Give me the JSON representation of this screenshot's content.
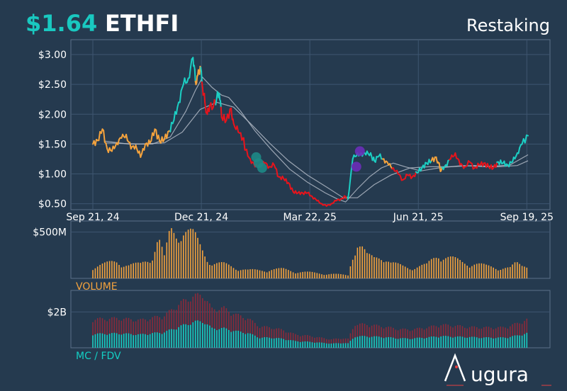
{
  "header": {
    "price": "$1.64",
    "ticker": "ETHFI",
    "category": "Restaking"
  },
  "colors": {
    "background": "#253a4f",
    "grid": "#3e5670",
    "frame": "#5a7088",
    "price_up": "#1ccfc4",
    "price_down": "#e8141c",
    "price_neutral": "#f5a33d",
    "ma": "#b0b8c4",
    "volume": "#f5a33d",
    "mcap": "#13cfc4",
    "fdv": "#8a2a3a",
    "marker_teal": "#1e8a86",
    "marker_purple": "#6c2fb8",
    "label": "#ffffff",
    "logo_accent": "#e84040"
  },
  "logo": {
    "text": "ugura"
  },
  "chart_data": [
    {
      "type": "line",
      "panel": "price",
      "x_ticks": [
        "Sep 21, 24",
        "Dec 21, 24",
        "Mar 22, 25",
        "Jun 21, 25",
        "Sep 19, 25"
      ],
      "y_ticks": [
        "$0.50",
        "$1.00",
        "$1.50",
        "$2.00",
        "$2.50",
        "$3.00"
      ],
      "ylim": [
        0.4,
        3.25
      ],
      "x_day_range": [
        0,
        365
      ],
      "grid": true,
      "series": [
        {
          "role": "price",
          "points": [
            [
              0,
              1.5
            ],
            [
              4,
              1.56
            ],
            [
              8,
              1.75
            ],
            [
              12,
              1.42
            ],
            [
              16,
              1.38
            ],
            [
              20,
              1.52
            ],
            [
              24,
              1.6
            ],
            [
              28,
              1.66
            ],
            [
              32,
              1.42
            ],
            [
              36,
              1.48
            ],
            [
              40,
              1.28
            ],
            [
              44,
              1.5
            ],
            [
              48,
              1.52
            ],
            [
              52,
              1.75
            ],
            [
              56,
              1.55
            ],
            [
              60,
              1.58
            ],
            [
              64,
              1.72
            ],
            [
              68,
              1.9
            ],
            [
              72,
              2.2
            ],
            [
              76,
              2.5
            ],
            [
              80,
              2.6
            ],
            [
              84,
              2.95
            ],
            [
              86,
              2.55
            ],
            [
              88,
              2.65
            ],
            [
              90,
              2.8
            ],
            [
              92,
              2.45
            ],
            [
              94,
              2.2
            ],
            [
              96,
              2.0
            ],
            [
              98,
              2.15
            ],
            [
              100,
              2.08
            ],
            [
              104,
              2.28
            ],
            [
              106,
              2.35
            ],
            [
              108,
              1.95
            ],
            [
              112,
              1.9
            ],
            [
              116,
              2.1
            ],
            [
              118,
              1.85
            ],
            [
              122,
              1.7
            ],
            [
              126,
              1.6
            ],
            [
              128,
              1.4
            ],
            [
              132,
              1.25
            ],
            [
              136,
              1.12
            ],
            [
              140,
              1.15
            ],
            [
              144,
              1.18
            ],
            [
              148,
              1.12
            ],
            [
              152,
              1.15
            ],
            [
              156,
              0.95
            ],
            [
              160,
              0.92
            ],
            [
              164,
              0.85
            ],
            [
              168,
              0.7
            ],
            [
              172,
              0.68
            ],
            [
              176,
              0.68
            ],
            [
              180,
              0.68
            ],
            [
              184,
              0.62
            ],
            [
              188,
              0.55
            ],
            [
              192,
              0.5
            ],
            [
              196,
              0.46
            ],
            [
              200,
              0.5
            ],
            [
              204,
              0.55
            ],
            [
              208,
              0.58
            ],
            [
              212,
              0.62
            ],
            [
              214,
              0.58
            ],
            [
              218,
              1.25
            ],
            [
              222,
              1.35
            ],
            [
              226,
              1.3
            ],
            [
              230,
              1.38
            ],
            [
              234,
              1.28
            ],
            [
              236,
              1.22
            ],
            [
              240,
              1.3
            ],
            [
              244,
              1.25
            ],
            [
              248,
              1.15
            ],
            [
              252,
              1.1
            ],
            [
              256,
              1.0
            ],
            [
              260,
              0.9
            ],
            [
              264,
              0.98
            ],
            [
              268,
              0.95
            ],
            [
              272,
              1.02
            ],
            [
              276,
              1.1
            ],
            [
              280,
              1.18
            ],
            [
              284,
              1.22
            ],
            [
              288,
              1.28
            ],
            [
              290,
              1.18
            ],
            [
              292,
              1.05
            ],
            [
              296,
              1.15
            ],
            [
              300,
              1.25
            ],
            [
              304,
              1.35
            ],
            [
              308,
              1.15
            ],
            [
              312,
              1.12
            ],
            [
              316,
              1.2
            ],
            [
              320,
              1.1
            ],
            [
              324,
              1.15
            ],
            [
              328,
              1.18
            ],
            [
              332,
              1.12
            ],
            [
              336,
              1.1
            ],
            [
              340,
              1.2
            ],
            [
              344,
              1.18
            ],
            [
              348,
              1.15
            ],
            [
              352,
              1.2
            ],
            [
              356,
              1.35
            ],
            [
              360,
              1.5
            ],
            [
              365,
              1.64
            ]
          ]
        },
        {
          "role": "moving-average-1",
          "points": [
            [
              10,
              1.55
            ],
            [
              30,
              1.5
            ],
            [
              50,
              1.5
            ],
            [
              65,
              1.62
            ],
            [
              78,
              2.05
            ],
            [
              86,
              2.4
            ],
            [
              92,
              2.62
            ],
            [
              100,
              2.45
            ],
            [
              108,
              2.32
            ],
            [
              114,
              2.28
            ],
            [
              124,
              2.05
            ],
            [
              136,
              1.72
            ],
            [
              150,
              1.4
            ],
            [
              165,
              1.08
            ],
            [
              180,
              0.86
            ],
            [
              195,
              0.68
            ],
            [
              205,
              0.58
            ],
            [
              212,
              0.53
            ],
            [
              222,
              0.75
            ],
            [
              232,
              0.95
            ],
            [
              242,
              1.1
            ],
            [
              252,
              1.18
            ],
            [
              262,
              1.12
            ],
            [
              275,
              1.05
            ],
            [
              290,
              1.1
            ],
            [
              310,
              1.14
            ],
            [
              330,
              1.12
            ],
            [
              350,
              1.15
            ],
            [
              365,
              1.32
            ]
          ]
        },
        {
          "role": "moving-average-2",
          "points": [
            [
              10,
              1.52
            ],
            [
              40,
              1.5
            ],
            [
              60,
              1.52
            ],
            [
              75,
              1.7
            ],
            [
              90,
              2.08
            ],
            [
              104,
              2.2
            ],
            [
              118,
              2.12
            ],
            [
              132,
              1.85
            ],
            [
              148,
              1.52
            ],
            [
              164,
              1.22
            ],
            [
              180,
              0.98
            ],
            [
              196,
              0.78
            ],
            [
              210,
              0.6
            ],
            [
              222,
              0.6
            ],
            [
              236,
              0.82
            ],
            [
              250,
              0.98
            ],
            [
              266,
              1.1
            ],
            [
              282,
              1.12
            ],
            [
              300,
              1.12
            ],
            [
              320,
              1.14
            ],
            [
              340,
              1.12
            ],
            [
              356,
              1.14
            ],
            [
              365,
              1.22
            ]
          ]
        }
      ],
      "markers": [
        {
          "x": 137,
          "y": 1.28,
          "color": "teal"
        },
        {
          "x": 139,
          "y": 1.18,
          "color": "teal"
        },
        {
          "x": 142,
          "y": 1.1,
          "color": "teal"
        },
        {
          "x": 221,
          "y": 1.12,
          "color": "purple"
        },
        {
          "x": 224,
          "y": 1.38,
          "color": "purple"
        }
      ]
    },
    {
      "type": "bar",
      "panel": "volume",
      "label": "VOLUME",
      "y_ticks": [
        "$500M"
      ],
      "ylim": [
        0,
        620
      ],
      "keypoints": [
        [
          0,
          120
        ],
        [
          10,
          140
        ],
        [
          20,
          170
        ],
        [
          30,
          130
        ],
        [
          40,
          140
        ],
        [
          50,
          230
        ],
        [
          55,
          400
        ],
        [
          60,
          200
        ],
        [
          65,
          480
        ],
        [
          70,
          460
        ],
        [
          75,
          500
        ],
        [
          80,
          460
        ],
        [
          85,
          420
        ],
        [
          90,
          320
        ],
        [
          95,
          230
        ],
        [
          100,
          150
        ],
        [
          110,
          140
        ],
        [
          120,
          110
        ],
        [
          130,
          80
        ],
        [
          140,
          80
        ],
        [
          150,
          90
        ],
        [
          160,
          90
        ],
        [
          170,
          70
        ],
        [
          180,
          60
        ],
        [
          190,
          50
        ],
        [
          200,
          45
        ],
        [
          210,
          35
        ],
        [
          214,
          30
        ],
        [
          218,
          250
        ],
        [
          222,
          350
        ],
        [
          226,
          300
        ],
        [
          230,
          220
        ],
        [
          236,
          200
        ],
        [
          242,
          240
        ],
        [
          250,
          150
        ],
        [
          260,
          120
        ],
        [
          270,
          110
        ],
        [
          280,
          130
        ],
        [
          290,
          250
        ],
        [
          295,
          220
        ],
        [
          300,
          200
        ],
        [
          310,
          160
        ],
        [
          320,
          150
        ],
        [
          330,
          120
        ],
        [
          340,
          110
        ],
        [
          350,
          100
        ],
        [
          355,
          150
        ],
        [
          360,
          130
        ],
        [
          365,
          150
        ]
      ]
    },
    {
      "type": "bar",
      "panel": "mc-fdv",
      "label": "MC / FDV",
      "y_ticks": [
        "$2B"
      ],
      "ylim": [
        0,
        3.2
      ],
      "keypoints": [
        [
          0,
          0.75,
          1.55
        ],
        [
          20,
          0.78,
          1.6
        ],
        [
          40,
          0.72,
          1.5
        ],
        [
          60,
          0.85,
          1.75
        ],
        [
          75,
          1.2,
          2.5
        ],
        [
          85,
          1.4,
          2.8
        ],
        [
          92,
          1.45,
          2.9
        ],
        [
          100,
          1.05,
          2.1
        ],
        [
          110,
          1.05,
          2.15
        ],
        [
          120,
          0.9,
          1.8
        ],
        [
          130,
          0.8,
          1.6
        ],
        [
          140,
          0.55,
          1.15
        ],
        [
          150,
          0.55,
          1.1
        ],
        [
          160,
          0.48,
          0.95
        ],
        [
          170,
          0.36,
          0.72
        ],
        [
          180,
          0.33,
          0.66
        ],
        [
          190,
          0.28,
          0.56
        ],
        [
          200,
          0.23,
          0.46
        ],
        [
          210,
          0.26,
          0.52
        ],
        [
          214,
          0.24,
          0.48
        ],
        [
          220,
          0.62,
          1.3
        ],
        [
          232,
          0.62,
          1.25
        ],
        [
          244,
          0.58,
          1.15
        ],
        [
          256,
          0.52,
          1.02
        ],
        [
          266,
          0.5,
          0.98
        ],
        [
          280,
          0.56,
          1.1
        ],
        [
          292,
          0.63,
          1.25
        ],
        [
          304,
          0.6,
          1.2
        ],
        [
          316,
          0.58,
          1.12
        ],
        [
          330,
          0.55,
          1.1
        ],
        [
          345,
          0.55,
          1.1
        ],
        [
          355,
          0.65,
          1.3
        ],
        [
          365,
          0.8,
          1.55
        ]
      ]
    }
  ]
}
